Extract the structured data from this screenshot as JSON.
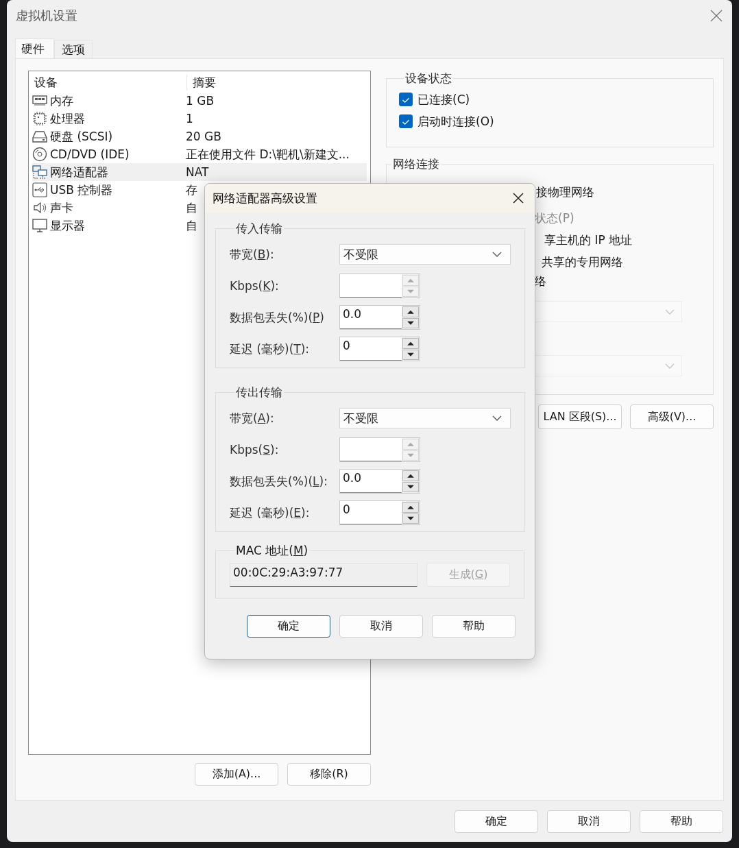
{
  "window": {
    "title": "虚拟机设置"
  },
  "tabs": [
    {
      "label": "硬件",
      "selected": true
    },
    {
      "label": "选项",
      "selected": false
    }
  ],
  "devices": {
    "columns": [
      "设备",
      "摘要"
    ],
    "rows": [
      {
        "kind": "memory",
        "name": "内存",
        "summary": "1 GB",
        "selected": false
      },
      {
        "kind": "processor",
        "name": "处理器",
        "summary": "1",
        "selected": false
      },
      {
        "kind": "disk",
        "name": "硬盘 (SCSI)",
        "summary": "20 GB",
        "selected": false
      },
      {
        "kind": "cd",
        "name": "CD/DVD (IDE)",
        "summary": "正在使用文件 D:\\靶机\\新建文...",
        "selected": false
      },
      {
        "kind": "network",
        "name": "网络适配器",
        "summary": "NAT",
        "selected": true
      },
      {
        "kind": "usb",
        "name": "USB 控制器",
        "summary": "存",
        "selected": false
      },
      {
        "kind": "sound",
        "name": "声卡",
        "summary": "自",
        "selected": false
      },
      {
        "kind": "display",
        "name": "显示器",
        "summary": "自",
        "selected": false
      }
    ]
  },
  "list_buttons": [
    "添加(A)...",
    "移除(R)"
  ],
  "device_status": {
    "title": "设备状态",
    "options": [
      {
        "label": "已连接(C)",
        "checked": true
      },
      {
        "label": "启动时连接(O)",
        "checked": true
      }
    ]
  },
  "network": {
    "title": "网络连接",
    "items": [
      {
        "kind": "text",
        "text": "接物理网络",
        "disabled": false
      },
      {
        "kind": "text",
        "text": "状态(P)",
        "disabled": true
      },
      {
        "kind": "text",
        "text": "享主机的 IP 地址",
        "disabled": false
      },
      {
        "kind": "text",
        "text": "共享的专用网络",
        "disabled": false
      },
      {
        "kind": "text",
        "text": "络",
        "disabled": false
      },
      {
        "kind": "dropdown",
        "disabled": true
      },
      {
        "kind": "dropdown",
        "disabled": true
      }
    ],
    "buttons": [
      "LAN 区段(S)...",
      "高级(V)..."
    ]
  },
  "footer_buttons": [
    "确定",
    "取消",
    "帮助"
  ],
  "dialog": {
    "title": "网络适配器高级设置",
    "groups": [
      {
        "title": "传入传输",
        "fields": [
          {
            "kind": "dropdown",
            "label": [
              "带宽(",
              "B",
              "):"
            ],
            "value": "不受限"
          },
          {
            "kind": "spinner",
            "label": [
              "Kbps(",
              "K",
              "):"
            ],
            "disabled": true
          },
          {
            "kind": "spinner",
            "label": [
              "数据包丢失(%)(",
              "P",
              ")"
            ],
            "value": "0.0",
            "disabled": false
          },
          {
            "kind": "spinner",
            "label": [
              "延迟 (毫秒)(",
              "T",
              "):"
            ],
            "value": "0",
            "disabled": false
          }
        ]
      },
      {
        "title": "传出传输",
        "fields": [
          {
            "kind": "dropdown",
            "label": [
              "带宽(",
              "A",
              "):"
            ],
            "value": "不受限"
          },
          {
            "kind": "spinner",
            "label": [
              "Kbps(",
              "S",
              "):"
            ],
            "disabled": true
          },
          {
            "kind": "spinner",
            "label": [
              "数据包丢失(%)(",
              "L",
              "):"
            ],
            "value": "0.0",
            "disabled": false
          },
          {
            "kind": "spinner",
            "label": [
              "延迟 (毫秒)(",
              "E",
              "):"
            ],
            "value": "0",
            "disabled": false
          }
        ]
      }
    ],
    "mac": {
      "title": [
        "MAC 地址(",
        "M",
        ")"
      ],
      "value": "00:0C:29:A3:97:77",
      "generate": {
        "label": [
          "生成(",
          "G",
          ")"
        ],
        "disabled": true
      }
    },
    "buttons": [
      {
        "label": "确定",
        "default": true
      },
      {
        "label": "取消",
        "default": false
      },
      {
        "label": "帮助",
        "default": false
      }
    ]
  }
}
